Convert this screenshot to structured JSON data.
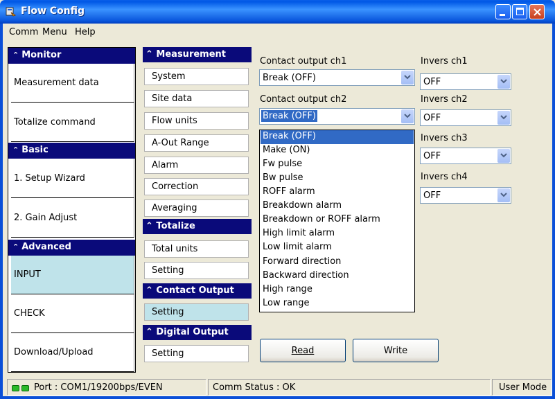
{
  "window": {
    "title": "Flow Config"
  },
  "menu": [
    "Comm",
    "Menu",
    "Help"
  ],
  "left_groups": [
    {
      "header": "Monitor",
      "items": [
        "Measurement data",
        "Totalize command"
      ]
    },
    {
      "header": "Basic",
      "items": [
        "1. Setup Wizard",
        "2. Gain Adjust"
      ]
    },
    {
      "header": "Advanced",
      "items": [
        "INPUT",
        "CHECK",
        "Download/Upload"
      ]
    }
  ],
  "mid_groups": [
    {
      "header": "Measurement",
      "items": [
        "System",
        "Site data",
        "Flow units",
        "A-Out Range",
        "Alarm",
        "Correction",
        "Averaging"
      ]
    },
    {
      "header": "Totalize",
      "items": [
        "Total units",
        "Setting"
      ]
    },
    {
      "header": "Contact Output",
      "items": [
        "Setting"
      ]
    },
    {
      "header": "Digital Output",
      "items": [
        "Setting"
      ]
    }
  ],
  "settings": {
    "contact_ch1_label": "Contact output ch1",
    "contact_ch1_value": "Break (OFF)",
    "contact_ch2_label": "Contact output ch2",
    "contact_ch2_value": "Break (OFF)",
    "invers": [
      {
        "label": "Invers ch1",
        "value": "OFF"
      },
      {
        "label": "Invers ch2",
        "value": "OFF"
      },
      {
        "label": "Invers ch3",
        "value": "OFF"
      },
      {
        "label": "Invers ch4",
        "value": "OFF"
      }
    ]
  },
  "dropdown_options": [
    "Break (OFF)",
    "Make (ON)",
    "Fw pulse",
    "Bw pulse",
    "ROFF alarm",
    "Breakdown alarm",
    "Breakdown or ROFF alarm",
    "High limit alarm",
    "Low limit alarm",
    "Forward direction",
    "Backward direction",
    "High range",
    "Low range"
  ],
  "buttons": {
    "read": "Read",
    "write": "Write"
  },
  "status": {
    "port": "Port : COM1/19200bps/EVEN",
    "comm": "Comm Status : OK",
    "mode": "User Mode"
  }
}
